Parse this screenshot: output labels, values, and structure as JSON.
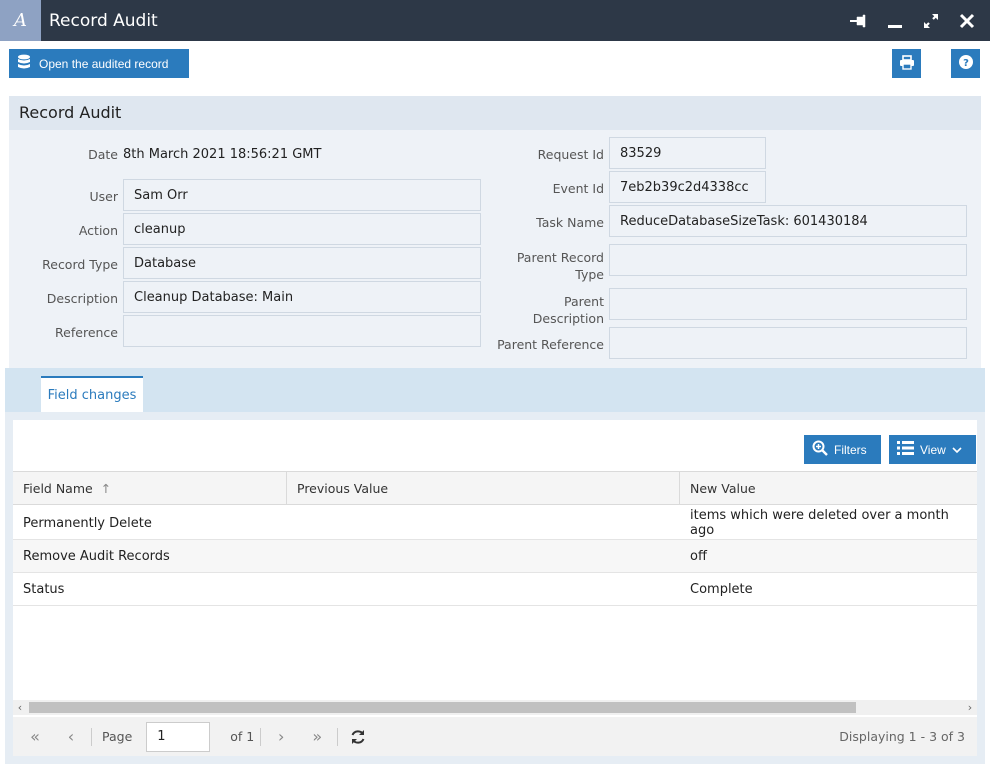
{
  "window": {
    "app_logo": "A",
    "title": "Record Audit",
    "controls": [
      "pin-icon",
      "minimize-icon",
      "maximize-icon",
      "close-icon"
    ]
  },
  "toolbar": {
    "open_label": "Open the audited record",
    "print_icon": "print-icon",
    "help_icon": "help-icon"
  },
  "panel": {
    "title": "Record Audit",
    "left_fields": [
      {
        "label": "Date",
        "value": "8th March 2021 18:56:21 GMT"
      },
      {
        "label": "User",
        "value": "Sam Orr"
      },
      {
        "label": "Action",
        "value": "cleanup"
      },
      {
        "label": "Record Type",
        "value": "Database"
      },
      {
        "label": "Description",
        "value": "Cleanup Database: Main"
      },
      {
        "label": "Reference",
        "value": ""
      }
    ],
    "right_fields": [
      {
        "label": "Request Id",
        "value": "83529"
      },
      {
        "label": "Event Id",
        "value": "7eb2b39c2d4338cc"
      },
      {
        "label": "Task Name",
        "value": "ReduceDatabaseSizeTask: 601430184"
      },
      {
        "label": "Parent Record Type",
        "label_lines": [
          "Parent Record",
          "Type"
        ],
        "value": ""
      },
      {
        "label": "Parent Description",
        "label_lines": [
          "Parent",
          "Description"
        ],
        "value": ""
      },
      {
        "label": "Parent Reference",
        "value": ""
      }
    ]
  },
  "tabs": [
    {
      "label": "Field changes",
      "active": true
    }
  ],
  "grid": {
    "filters_label": "Filters",
    "view_label": "View",
    "columns": [
      "Field Name",
      "Previous Value",
      "New Value"
    ],
    "sort_indicator": "↑",
    "rows": [
      {
        "field": "Permanently Delete",
        "previous": "",
        "new": "items which were deleted over a month ago"
      },
      {
        "field": "Remove Audit Records",
        "previous": "",
        "new": "off"
      },
      {
        "field": "Status",
        "previous": "",
        "new": "Complete"
      }
    ]
  },
  "pager": {
    "page_label": "Page",
    "page_value": "1",
    "of_label": "of 1",
    "displaying": "Displaying 1 - 3 of 3"
  },
  "colors": {
    "titlebar": "#2d3847",
    "accent": "#2b7bbd",
    "panel_header": "#dfe7f0",
    "panel_body": "#eef2f7",
    "tab_strip": "#d3e4f1"
  }
}
